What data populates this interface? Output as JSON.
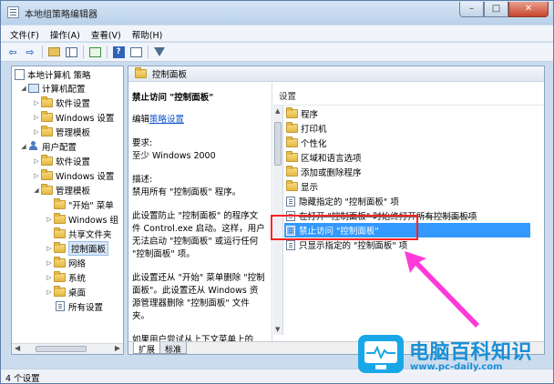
{
  "window": {
    "title": "本地组策略编辑器",
    "controls": {
      "minimize": "–",
      "maximize": "□",
      "close": "✕"
    }
  },
  "menu": [
    "文件(F)",
    "操作(A)",
    "查看(V)",
    "帮助(H)"
  ],
  "toolbar": {
    "icons": [
      "back-arrow-icon",
      "forward-arrow-icon",
      "folder-up-icon",
      "show-hide-pane-icon",
      "export-list-icon",
      "help-icon",
      "properties-icon",
      "filter-icon"
    ]
  },
  "tree": {
    "items": [
      {
        "label": "本地计算机 策略",
        "icon": "policy-icon",
        "expander": ""
      },
      {
        "label": "计算机配置",
        "icon": "computer-icon",
        "expander": "◢"
      },
      {
        "label": "软件设置",
        "icon": "folder-icon",
        "expander": "▷"
      },
      {
        "label": "Windows 设置",
        "icon": "folder-icon",
        "expander": "▷"
      },
      {
        "label": "管理模板",
        "icon": "folder-icon",
        "expander": "▷"
      },
      {
        "label": "用户配置",
        "icon": "user-icon",
        "expander": "◢"
      },
      {
        "label": "软件设置",
        "icon": "folder-icon",
        "expander": "▷"
      },
      {
        "label": "Windows 设置",
        "icon": "folder-icon",
        "expander": "▷"
      },
      {
        "label": "管理模板",
        "icon": "folder-icon",
        "expander": "◢"
      },
      {
        "label": "\"开始\" 菜单",
        "icon": "folder-icon",
        "expander": ""
      },
      {
        "label": "Windows 组",
        "icon": "folder-icon",
        "expander": "▷"
      },
      {
        "label": "共享文件夹",
        "icon": "folder-icon",
        "expander": ""
      },
      {
        "label": "控制面板",
        "icon": "folder-icon",
        "expander": "▷"
      },
      {
        "label": "网络",
        "icon": "folder-icon",
        "expander": "▷"
      },
      {
        "label": "系统",
        "icon": "folder-icon",
        "expander": "▷"
      },
      {
        "label": "桌面",
        "icon": "folder-icon",
        "expander": "▷"
      },
      {
        "label": "所有设置",
        "icon": "settings-icon",
        "expander": ""
      }
    ],
    "selected_index": 12
  },
  "right": {
    "header_title": "控制面板",
    "extended": {
      "title": "禁止访问 \"控制面板\"",
      "edit_prefix": "编辑",
      "edit_link": "策略设置",
      "req_label": "要求:",
      "req_value": "至少 Windows 2000",
      "desc_label": "描述:",
      "desc_value": "禁用所有 \"控制面板\" 程序。",
      "para1": "此设置防止 \"控制面板\" 的程序文件 Control.exe 启动。这样，用户无法启动 \"控制面板\" 或运行任何 \"控制面板\" 项。",
      "para2": "此设置还从 \"开始\" 菜单删除 \"控制面板\"。此设置还从 Windows 资源管理器删除 \"控制面板\" 文件夹。",
      "para3": "如果用户尝试从上下文菜单上的 \"属性\" 项选择 \"控制面板\" 项"
    },
    "list": {
      "column_header": "设置",
      "items": [
        {
          "label": "程序",
          "type": "folder"
        },
        {
          "label": "打印机",
          "type": "folder"
        },
        {
          "label": "个性化",
          "type": "folder"
        },
        {
          "label": "区域和语言选项",
          "type": "folder"
        },
        {
          "label": "添加或删除程序",
          "type": "folder"
        },
        {
          "label": "显示",
          "type": "folder"
        },
        {
          "label": "隐藏指定的 \"控制面板\" 项",
          "type": "setting"
        },
        {
          "label": "在打开 \"控制面板\" 时始终打开所有控制面板项",
          "type": "setting"
        },
        {
          "label": "禁止访问 \"控制面板\"",
          "type": "setting"
        },
        {
          "label": "只显示指定的 \"控制面板\" 项",
          "type": "setting"
        }
      ],
      "selected_index": 8
    },
    "tabs": [
      "扩展",
      "标准"
    ]
  },
  "status": {
    "text": "4 个设置"
  },
  "watermark": {
    "title": "电脑百科知识",
    "url": "www.pc-daily.com"
  },
  "colors": {
    "selection": "#3399ff",
    "annotation_box": "#ff2222",
    "annotation_arrow": "#ff3ad8",
    "watermark_blue": "#1a8fd6"
  }
}
